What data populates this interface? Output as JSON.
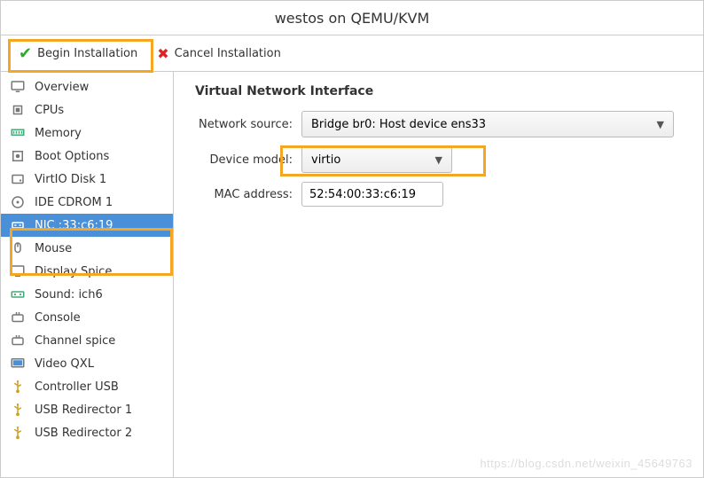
{
  "title": "westos on QEMU/KVM",
  "toolbar": {
    "begin_label": "Begin Installation",
    "cancel_label": "Cancel Installation"
  },
  "sidebar": {
    "items": [
      {
        "label": "Overview",
        "icon": "monitor"
      },
      {
        "label": "CPUs",
        "icon": "cpu"
      },
      {
        "label": "Memory",
        "icon": "memory"
      },
      {
        "label": "Boot Options",
        "icon": "boot"
      },
      {
        "label": "VirtIO Disk 1",
        "icon": "disk"
      },
      {
        "label": "IDE CDROM 1",
        "icon": "cdrom"
      },
      {
        "label": "NIC :33:c6:19",
        "icon": "nic"
      },
      {
        "label": "Mouse",
        "icon": "mouse"
      },
      {
        "label": "Display Spice",
        "icon": "display"
      },
      {
        "label": "Sound: ich6",
        "icon": "sound"
      },
      {
        "label": "Console",
        "icon": "console"
      },
      {
        "label": "Channel spice",
        "icon": "console"
      },
      {
        "label": "Video QXL",
        "icon": "video"
      },
      {
        "label": "Controller USB",
        "icon": "usb"
      },
      {
        "label": "USB Redirector 1",
        "icon": "usb"
      },
      {
        "label": "USB Redirector 2",
        "icon": "usb"
      }
    ],
    "selected_index": 6
  },
  "panel": {
    "title": "Virtual Network Interface",
    "network_source": {
      "label": "Network source:",
      "value": "Bridge br0: Host device ens33"
    },
    "device_model": {
      "label": "Device model:",
      "value": "virtio"
    },
    "mac": {
      "label": "MAC address:",
      "value": "52:54:00:33:c6:19"
    }
  },
  "watermark": "https://blog.csdn.net/weixin_45649763"
}
